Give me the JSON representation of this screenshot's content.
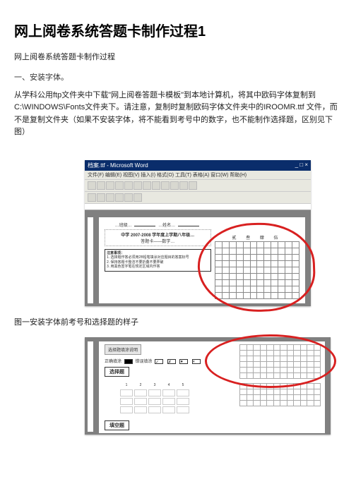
{
  "title": "网上阅卷系统答题卡制作过程1",
  "subtitle": "网上阅卷系统答题卡制作过程",
  "section1": "一、安装字体。",
  "para1": "从学科公用ftp文件夹中下载\"网上阅卷答题卡模板\"到本地计算机，将其中欧码字体复制到C:\\WINDOWS\\Fonts文件夹下。请注意，复制时复制欧码字体文件夹中的IROOMR.ttf 文件，而不是复制文件夹（如果不安装字体，将不能看到考号中的数字，也不能制作选择题，区别见下图）",
  "caption1": "图一安装字体前考号和选择题的样子",
  "word_app": {
    "title_left": "档案.ttf - Microsoft Word",
    "menu": "文件(F)  编辑(E)  视图(V)  插入(I)  格式(O)  工具(T)  表格(A)  窗口(W)  帮助(H)",
    "page_header_left": "…班级…",
    "page_header_right": "…姓名…",
    "exam_title": "中学 2007-2008 学年度上学期八年级…",
    "answer_card": "答题卡——数学…",
    "notice_title": "注意事项：",
    "notice1": "1. 选择题作答必须用2B铅笔填涂对应题目的答案标号",
    "notice2": "2. 保持答题卡整洁不要折叠不要弄破",
    "notice3": "3. 用黑色签字笔在规定区域内作答",
    "bubble_header": "贰  叁  肆  伍"
  },
  "shot2": {
    "shade_title": "选择题填涂说明",
    "correct": "正确填涂",
    "wrong": "错误填涂",
    "select_label": "选择题",
    "fill_label": "填空题",
    "row_nums": [
      "1",
      "2",
      "3",
      "4",
      "5"
    ]
  }
}
